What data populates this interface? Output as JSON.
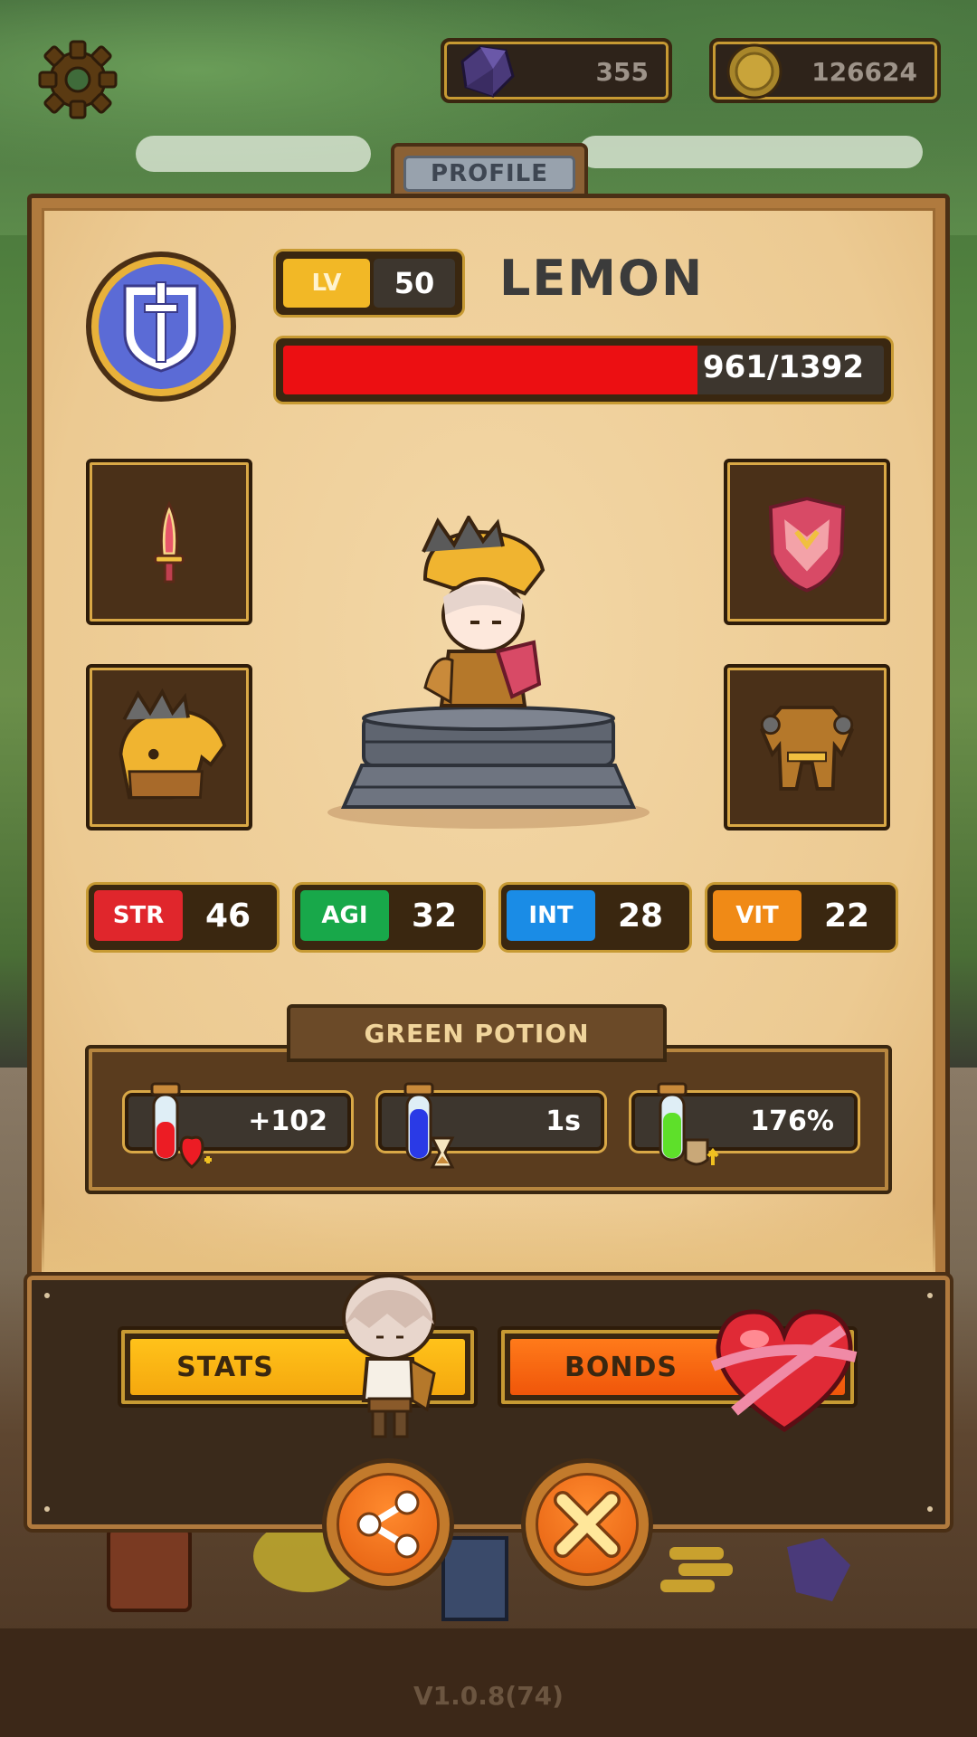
{
  "currencies": {
    "gems": "355",
    "coins": "126624"
  },
  "profile_tab": "PROFILE",
  "player": {
    "level_label": "LV",
    "level": "50",
    "name": "LEMON",
    "hp_text": "961/1392",
    "hp_fraction": 0.69
  },
  "stats": [
    {
      "label": "STR",
      "value": "46",
      "color": "#e0262c"
    },
    {
      "label": "AGI",
      "value": "32",
      "color": "#18a84a"
    },
    {
      "label": "INT",
      "value": "28",
      "color": "#1a8ce6"
    },
    {
      "label": "VIT",
      "value": "22",
      "color": "#f08a16"
    }
  ],
  "potion": {
    "title": "GREEN POTION",
    "items": [
      {
        "icon": "red-potion-heart-icon",
        "value": "+102"
      },
      {
        "icon": "blue-potion-hourglass-icon",
        "value": "1s"
      },
      {
        "icon": "green-potion-armor-icon",
        "value": "176%"
      }
    ]
  },
  "buttons": {
    "stats": "STATS",
    "bonds": "BONDS"
  },
  "version": "V1.0.8(74)"
}
